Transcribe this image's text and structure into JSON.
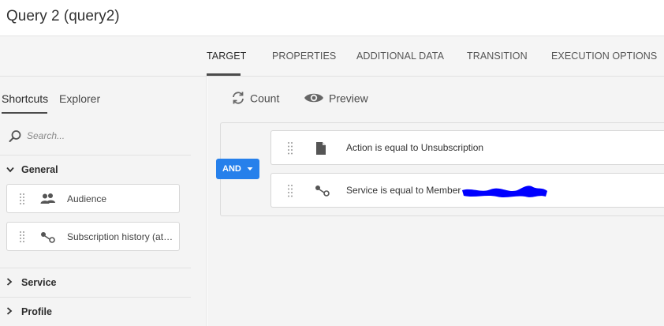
{
  "window": {
    "title": "Query 2 (query2)"
  },
  "tabs": [
    {
      "label": "TARGET",
      "active": true
    },
    {
      "label": "PROPERTIES"
    },
    {
      "label": "ADDITIONAL DATA"
    },
    {
      "label": "TRANSITION"
    },
    {
      "label": "EXECUTION OPTIONS"
    }
  ],
  "sidebar": {
    "tabs": [
      {
        "label": "Shortcuts",
        "active": true
      },
      {
        "label": "Explorer"
      }
    ],
    "search": {
      "placeholder": "Search...",
      "value": ""
    },
    "groups": [
      {
        "label": "General",
        "expanded": true,
        "items": [
          {
            "label": "Audience",
            "icon": "audience-icon"
          },
          {
            "label": "Subscription history (att…",
            "icon": "link-icon"
          }
        ]
      },
      {
        "label": "Service",
        "expanded": false
      },
      {
        "label": "Profile",
        "expanded": false
      }
    ]
  },
  "toolbar": {
    "count_label": "Count",
    "preview_label": "Preview"
  },
  "query": {
    "operator": "AND",
    "conditions": [
      {
        "text": "Action is equal to Unsubscription",
        "icon": "document-icon"
      },
      {
        "text": "Service is equal to Member",
        "icon": "link-icon",
        "redacted": true
      }
    ]
  },
  "colors": {
    "accent": "#2680eb",
    "redaction": "#0000ff"
  }
}
